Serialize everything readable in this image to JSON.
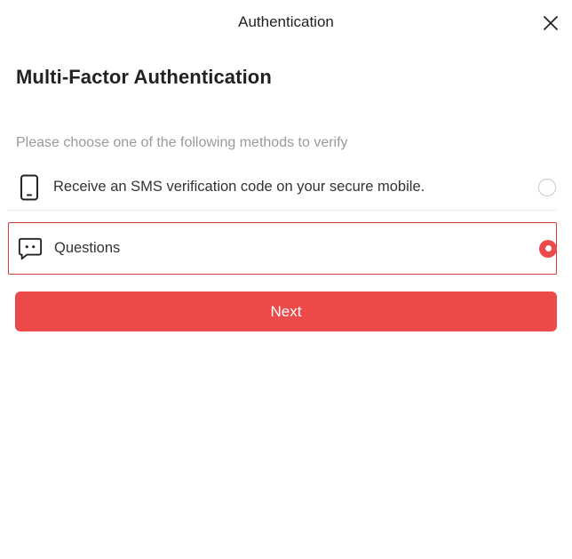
{
  "header": {
    "title": "Authentication",
    "close_icon": "close-icon"
  },
  "page": {
    "title": "Multi-Factor Authentication",
    "instructions": "Please choose one of the following methods to verify"
  },
  "options": [
    {
      "icon": "mobile-phone-icon",
      "label": "Receive an SMS verification code on your secure mobile.",
      "selected": false
    },
    {
      "icon": "chat-bubble-icon",
      "label": "Questions",
      "selected": true
    }
  ],
  "actions": {
    "next_label": "Next"
  },
  "colors": {
    "accent": "#ec4a4a",
    "selected_border": "#d63a3a",
    "muted_text": "#9a9a9a"
  }
}
